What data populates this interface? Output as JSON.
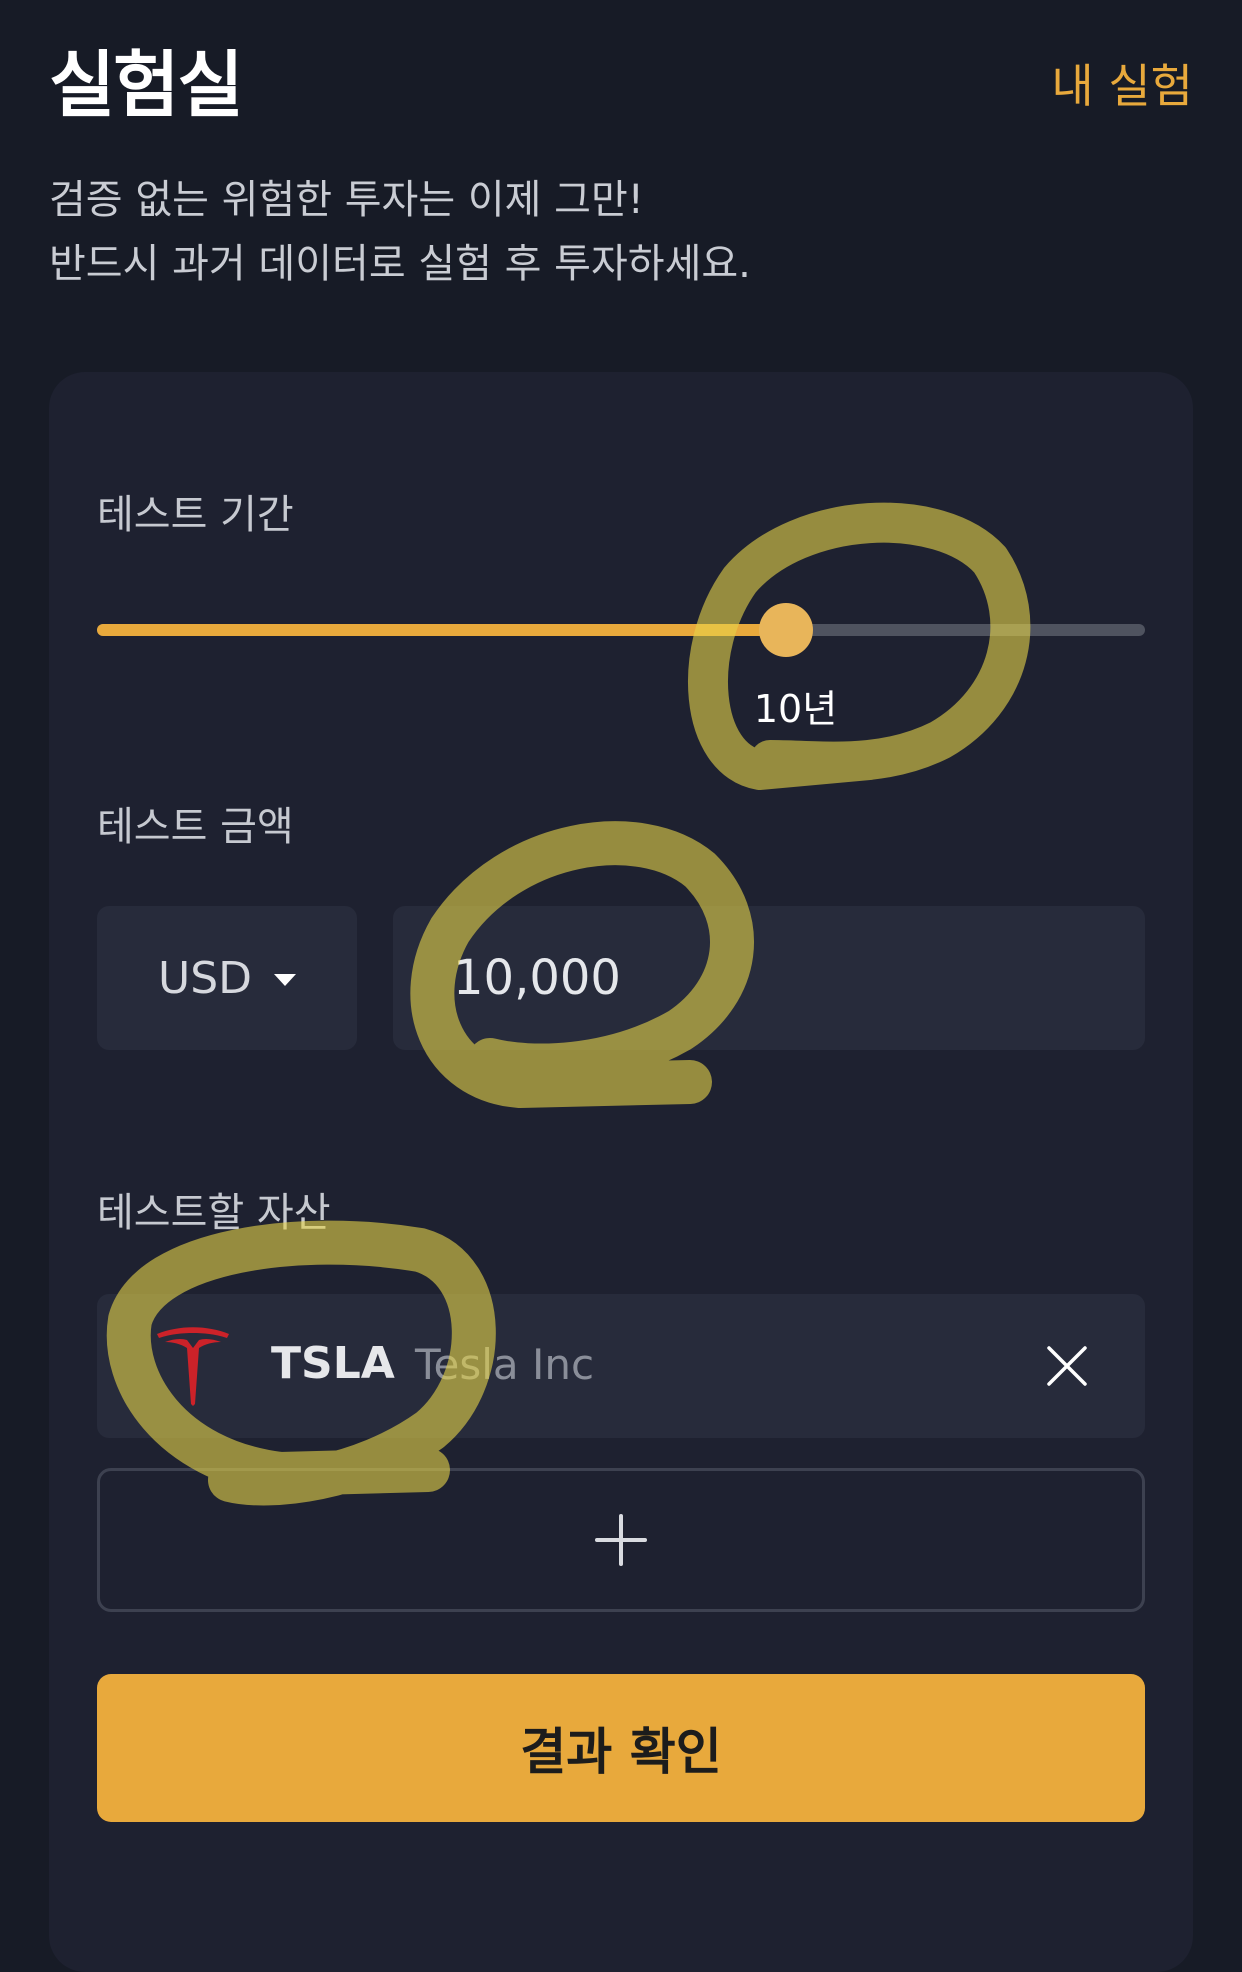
{
  "header": {
    "title": "실험실",
    "link_label": "내 실험"
  },
  "subtitle": {
    "line1": "검증 없는 위험한 투자는 이제 그만!",
    "line2": "반드시 과거 데이터로 실험 후 투자하세요."
  },
  "period": {
    "label": "테스트 기간",
    "value_label": "10년",
    "slider_fraction": 0.657
  },
  "amount": {
    "label": "테스트 금액",
    "currency": "USD",
    "value": "10,000"
  },
  "assets": {
    "label": "테스트할 자산",
    "items": [
      {
        "ticker": "TSLA",
        "name": "Tesla Inc",
        "logo_icon": "tesla-logo-icon"
      }
    ],
    "add_icon": "plus-icon"
  },
  "submit": {
    "label": "결과 확인"
  },
  "colors": {
    "background": "#171b26",
    "card": "#1e2130",
    "accent": "#e8a93c",
    "field": "#272b3b",
    "tesla_red": "#cc2229",
    "highlighter": "#e6d44a"
  }
}
